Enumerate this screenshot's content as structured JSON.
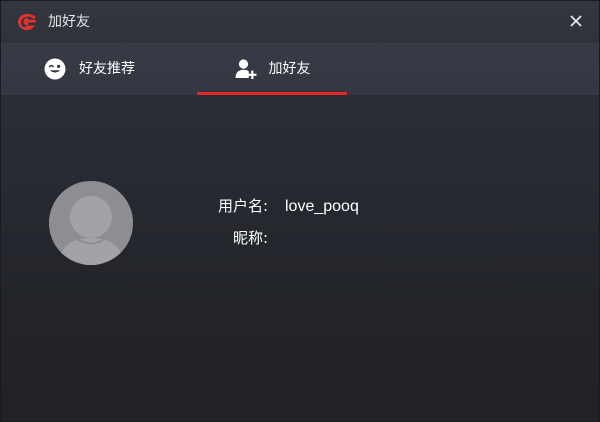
{
  "window": {
    "title": "加好友",
    "logo_icon": "garena-logo-icon",
    "close_icon": "close-icon"
  },
  "tabs": [
    {
      "label": "好友推荐",
      "icon": "wink-smiley-icon",
      "active": false
    },
    {
      "label": "加好友",
      "icon": "add-user-icon",
      "active": true
    }
  ],
  "profile": {
    "avatar_icon": "default-avatar-icon",
    "username_label": "用户名:",
    "username_value": "love_pooq",
    "nickname_label": "昵称:",
    "nickname_value": ""
  },
  "colors": {
    "accent": "#e02a2a",
    "background_top": "#33363f",
    "background_bottom": "#202227",
    "text": "#ffffff"
  }
}
